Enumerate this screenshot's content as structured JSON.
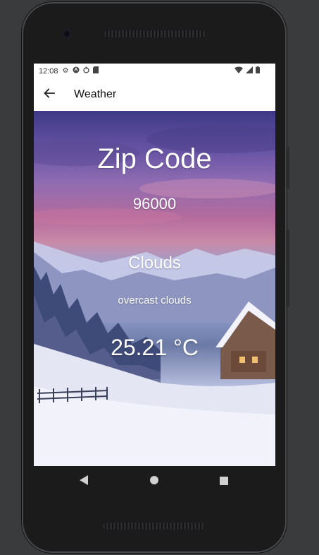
{
  "status_bar": {
    "time": "12:08",
    "left_icons": [
      "settings-icon",
      "android-icon",
      "data-saver-icon",
      "sd-card-icon"
    ],
    "right_icons": [
      "wifi-icon",
      "signal-icon",
      "battery-icon"
    ]
  },
  "app_bar": {
    "title": "Weather",
    "back_icon": "arrow-back-icon"
  },
  "weather": {
    "heading": "Zip Code",
    "zip": "96000",
    "main": "Clouds",
    "description": "overcast clouds",
    "temperature": "25.21 °C"
  },
  "colors": {
    "text": "#ffffff",
    "app_bar_bg": "#ffffff",
    "phone_frame": "#1b1b1c"
  },
  "nav_bar": [
    "back-icon",
    "home-icon",
    "recents-icon"
  ]
}
